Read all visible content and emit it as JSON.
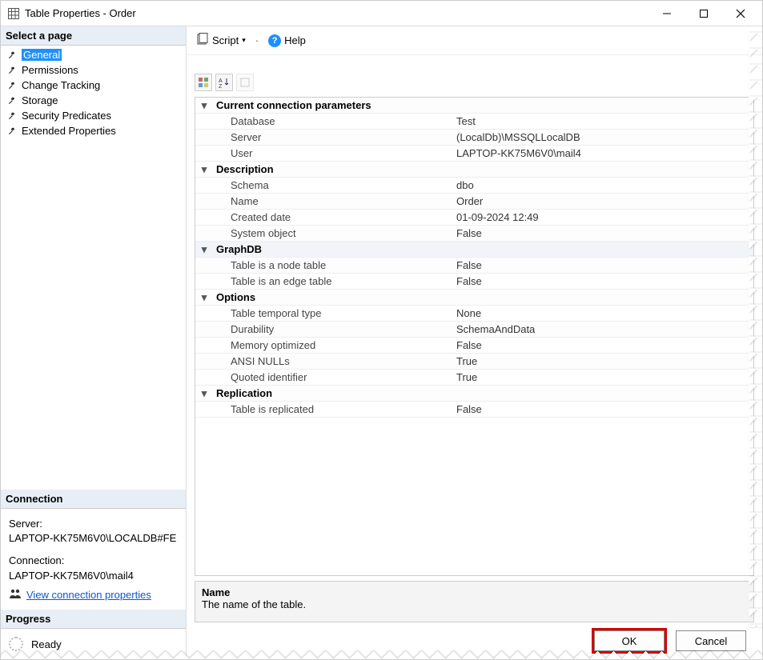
{
  "window": {
    "title": "Table Properties - Order"
  },
  "sidebar": {
    "select_page_header": "Select a page",
    "pages": [
      {
        "label": "General",
        "selected": true
      },
      {
        "label": "Permissions"
      },
      {
        "label": "Change Tracking"
      },
      {
        "label": "Storage"
      },
      {
        "label": "Security Predicates"
      },
      {
        "label": "Extended Properties"
      }
    ],
    "connection_header": "Connection",
    "server_label": "Server:",
    "server_value": "LAPTOP-KK75M6V0\\LOCALDB#FE",
    "connection_label": "Connection:",
    "connection_value": "LAPTOP-KK75M6V0\\mail4",
    "view_conn_link": "View connection properties",
    "progress_header": "Progress",
    "progress_status": "Ready"
  },
  "toolbar": {
    "script_label": "Script",
    "help_label": "Help"
  },
  "propgrid": {
    "categories": [
      {
        "name": "Current connection parameters",
        "rows": [
          {
            "name": "Database",
            "value": "Test"
          },
          {
            "name": "Server",
            "value": "(LocalDb)\\MSSQLLocalDB"
          },
          {
            "name": "User",
            "value": "LAPTOP-KK75M6V0\\mail4"
          }
        ]
      },
      {
        "name": "Description",
        "rows": [
          {
            "name": "Schema",
            "value": "dbo"
          },
          {
            "name": "Name",
            "value": "Order"
          },
          {
            "name": "Created date",
            "value": "01-09-2024 12:49"
          },
          {
            "name": "System object",
            "value": "False"
          }
        ]
      },
      {
        "name": "GraphDB",
        "rows": [
          {
            "name": "Table is a node table",
            "value": "False"
          },
          {
            "name": "Table is an edge table",
            "value": "False"
          }
        ]
      },
      {
        "name": "Options",
        "rows": [
          {
            "name": "Table temporal type",
            "value": "None"
          },
          {
            "name": "Durability",
            "value": "SchemaAndData"
          },
          {
            "name": "Memory optimized",
            "value": "False"
          },
          {
            "name": "ANSI NULLs",
            "value": "True"
          },
          {
            "name": "Quoted identifier",
            "value": "True"
          }
        ]
      },
      {
        "name": "Replication",
        "rows": [
          {
            "name": "Table is replicated",
            "value": "False"
          }
        ]
      }
    ]
  },
  "description_pane": {
    "title": "Name",
    "text": "The name of the table."
  },
  "footer": {
    "ok": "OK",
    "cancel": "Cancel"
  }
}
